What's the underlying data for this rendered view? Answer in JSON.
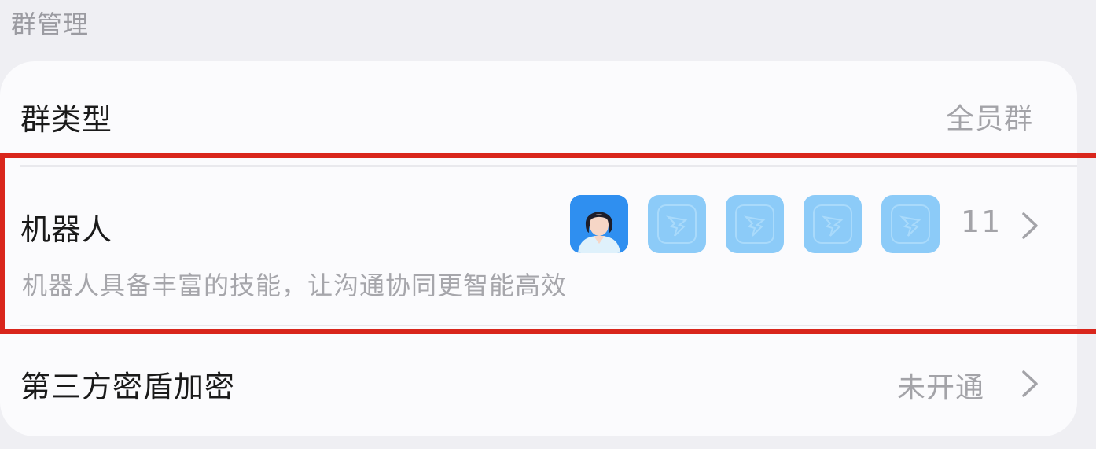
{
  "section": {
    "title": "群管理"
  },
  "settings": {
    "group_type": {
      "label": "群类型",
      "value": "全员群"
    },
    "robots": {
      "label": "机器人",
      "description": "机器人具备丰富的技能，让沟通协同更智能高效",
      "count": "11",
      "avatars": [
        {
          "icon": "person-avatar-icon"
        },
        {
          "icon": "dingtalk-bot-icon"
        },
        {
          "icon": "dingtalk-bot-icon"
        },
        {
          "icon": "dingtalk-bot-icon"
        },
        {
          "icon": "dingtalk-bot-icon"
        }
      ]
    },
    "encryption": {
      "label": "第三方密盾加密",
      "value": "未开通"
    }
  },
  "colors": {
    "background": "#efeff3",
    "card": "#fbfbfd",
    "highlight": "#d9261c",
    "bot_avatar": "#8ccbf8"
  }
}
